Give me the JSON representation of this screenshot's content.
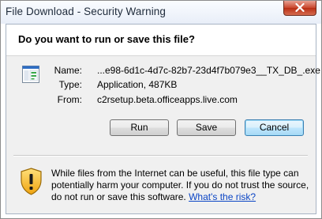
{
  "window": {
    "title": "File Download - Security Warning"
  },
  "dialog": {
    "question": "Do you want to run or save this file?",
    "file": {
      "name_label": "Name:",
      "name_value": "...e98-6d1c-4d7c-82b7-23d4f7b079e3__TX_DB_.exe",
      "type_label": "Type:",
      "type_value": "Application, 487KB",
      "from_label": "From:",
      "from_value": "c2rsetup.beta.officeapps.live.com"
    },
    "buttons": {
      "run": "Run",
      "save": "Save",
      "cancel": "Cancel"
    },
    "warning": {
      "text": "While files from the Internet can be useful, this file type can potentially harm your computer. If you do not trust the source, do not run or save this software. ",
      "link": "What's the risk?"
    }
  }
}
